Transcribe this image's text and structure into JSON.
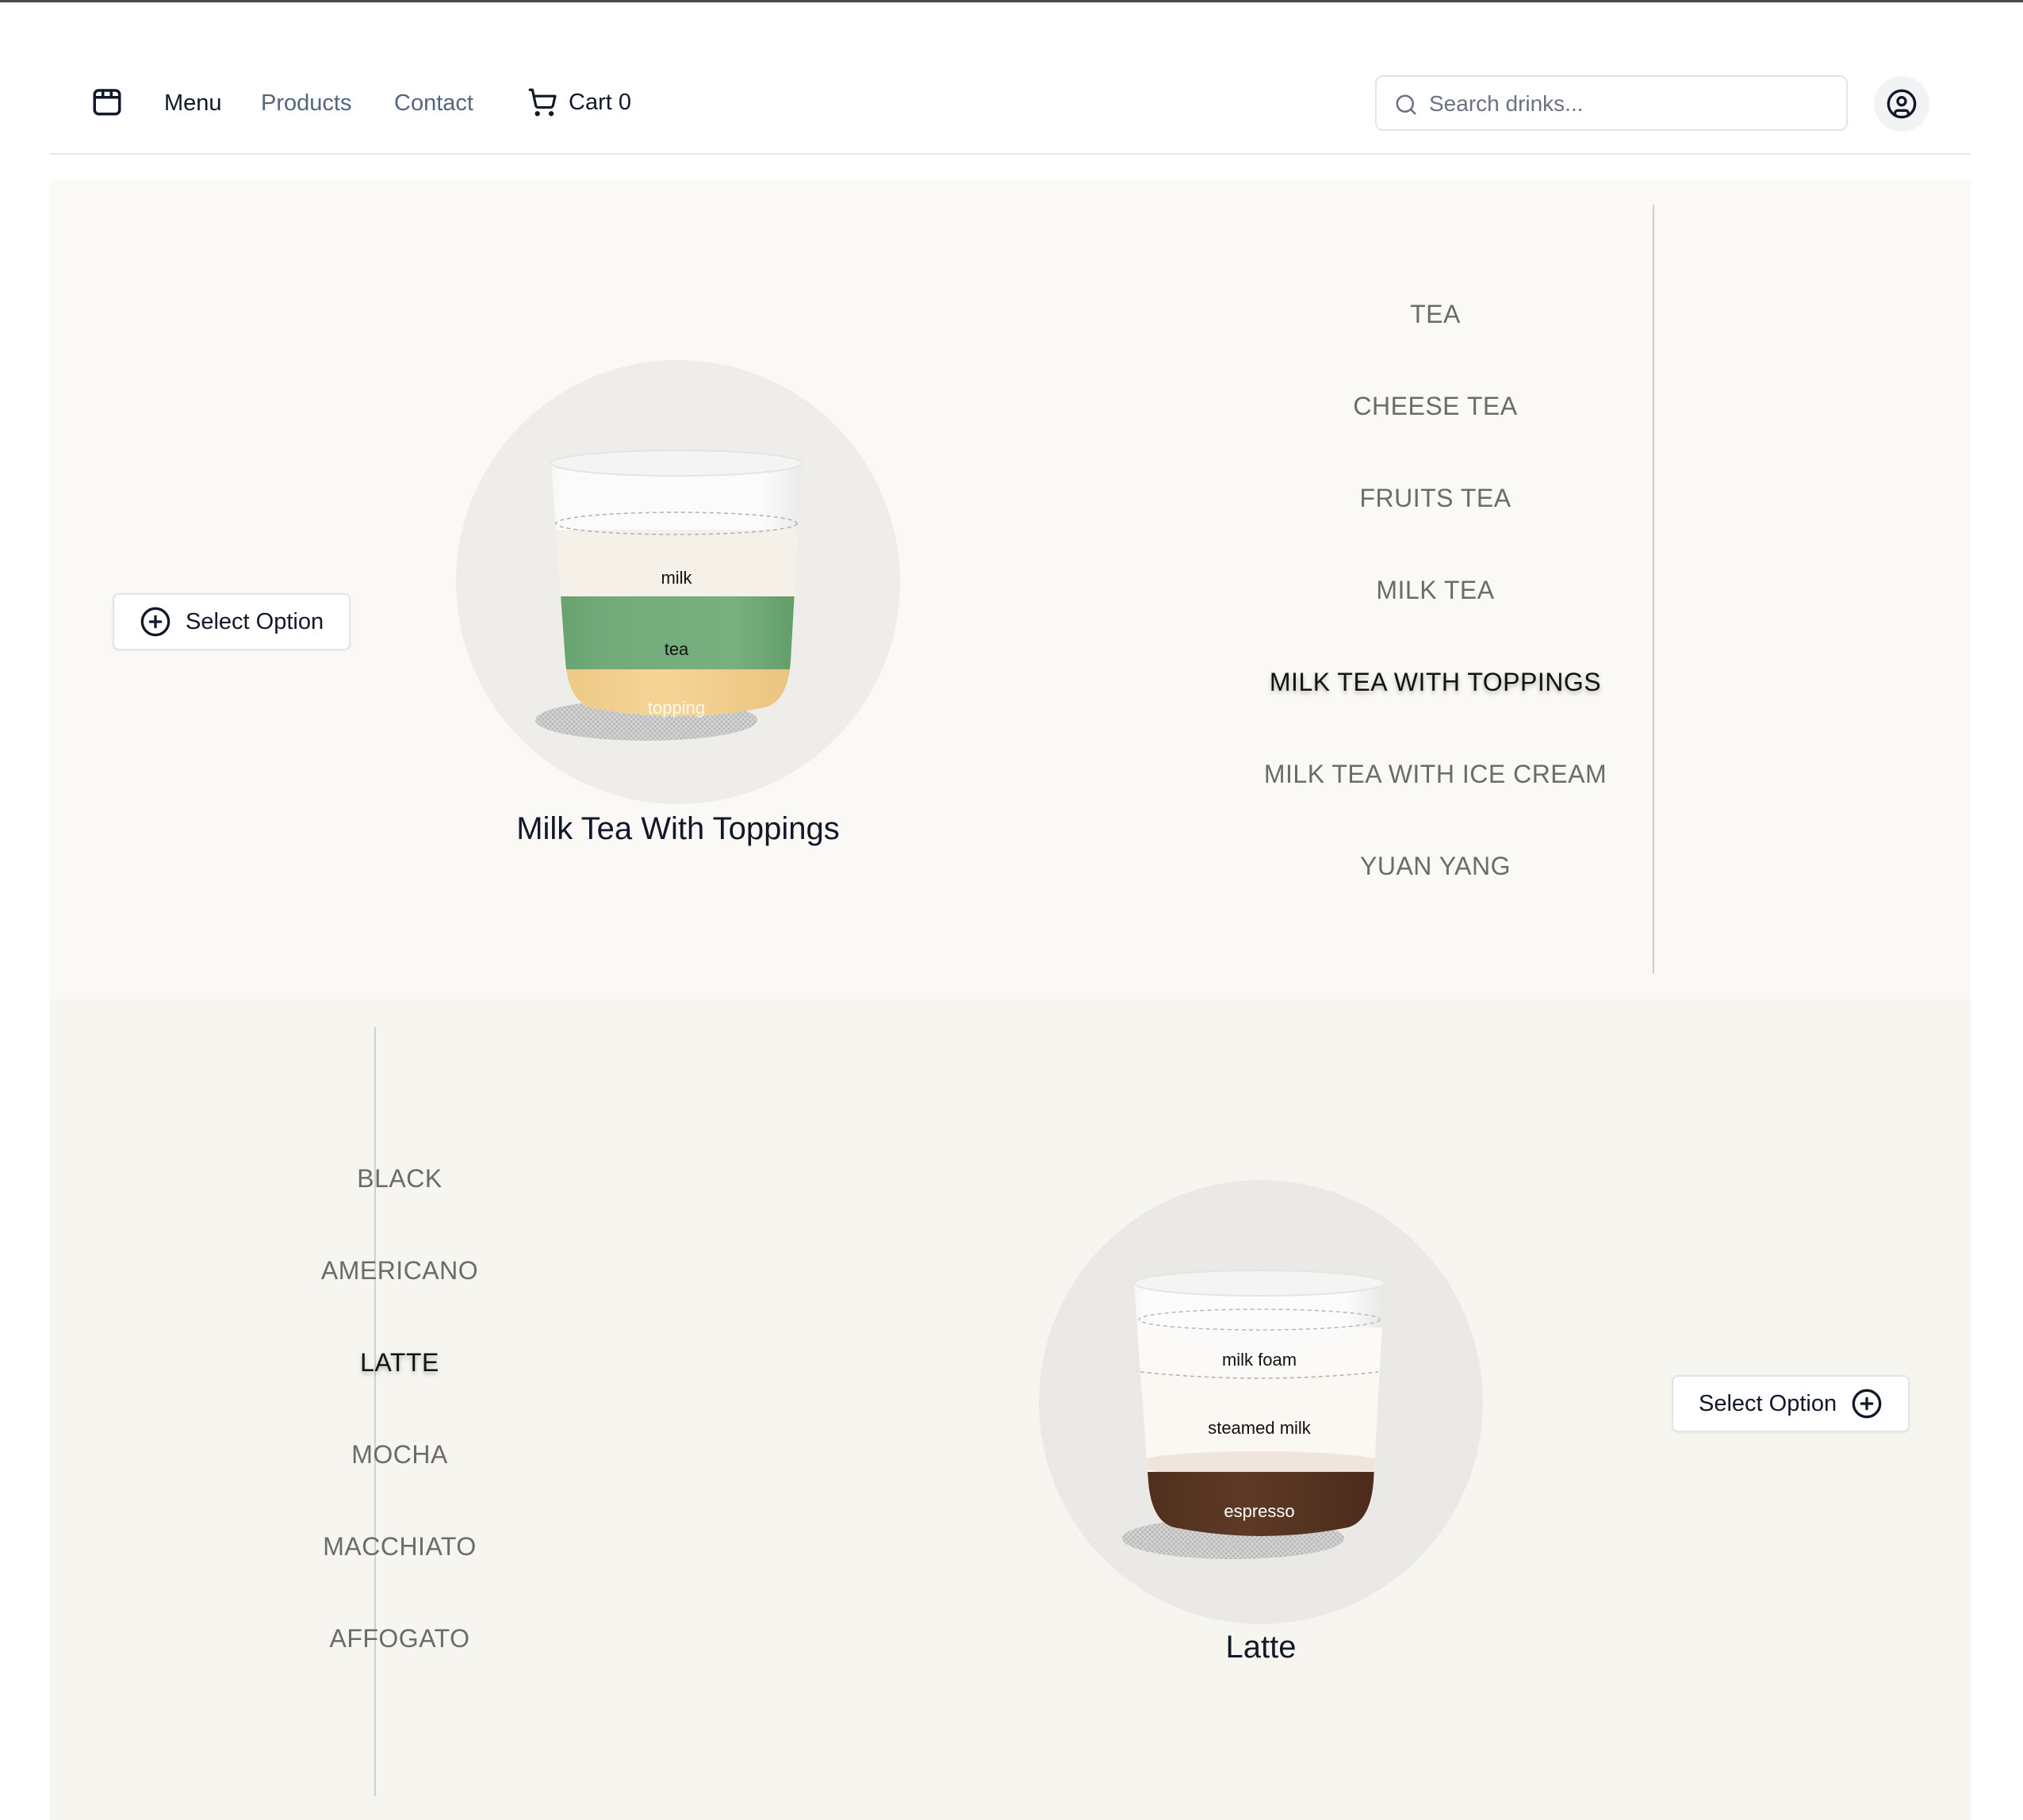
{
  "header": {
    "logo_icon": "storefront-icon",
    "nav": {
      "menu": "Menu",
      "products": "Products",
      "contact": "Contact"
    },
    "cart_label": "Cart 0",
    "search_placeholder": "Search drinks...",
    "account_icon": "user-circle-icon"
  },
  "tea_section": {
    "select_label": "Select Option",
    "drink_title": "Milk Tea With Toppings",
    "layers": {
      "top": "milk",
      "middle": "tea",
      "bottom": "topping"
    },
    "categories": [
      "TEA",
      "CHEESE TEA",
      "FRUITS TEA",
      "MILK TEA",
      "MILK TEA WITH TOPPINGS",
      "MILK TEA WITH ICE CREAM",
      "YUAN YANG"
    ],
    "active_category": "MILK TEA WITH TOPPINGS",
    "colors": {
      "milk": "#f6f1e8",
      "tea": "#72ab79",
      "topping": "#f3d190"
    }
  },
  "coffee_section": {
    "select_label": "Select Option",
    "drink_title": "Latte",
    "layers": {
      "top": "milk foam",
      "middle": "steamed milk",
      "bottom": "espresso"
    },
    "categories": [
      "BLACK",
      "AMERICANO",
      "LATTE",
      "MOCHA",
      "MACCHIATO",
      "AFFOGATO"
    ],
    "active_category": "LATTE",
    "colors": {
      "milk_foam": "#fbfaf8",
      "steamed_milk": "#fbf7f3",
      "espresso": "#5a3623"
    }
  }
}
